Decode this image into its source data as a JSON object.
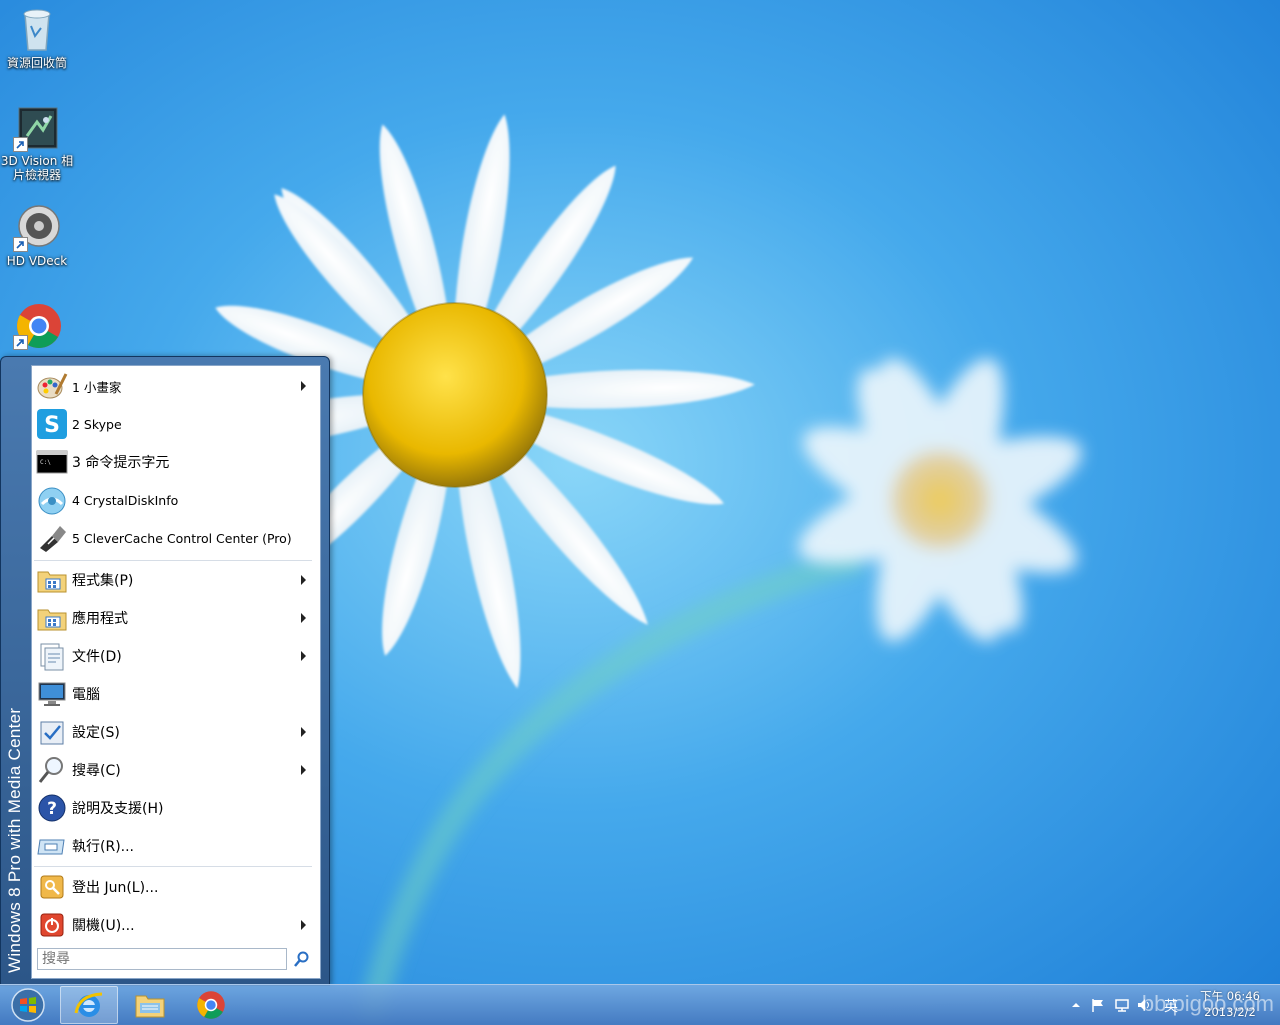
{
  "desktop": {
    "icons": [
      {
        "label": "資源回收筒",
        "icon": "recycle-bin-icon"
      },
      {
        "label": "3D Vision 相片檢視器",
        "icon": "3d-vision-icon"
      },
      {
        "label": "HD VDeck",
        "icon": "hd-vdeck-icon"
      },
      {
        "label": "Google Chrome",
        "icon": "chrome-icon"
      }
    ]
  },
  "start_menu": {
    "sidebar_text": "Windows 8 Pro with Media Center",
    "recent": [
      {
        "label": "1 小畫家",
        "icon": "paint-icon",
        "submenu": true
      },
      {
        "label": "2 Skype",
        "icon": "skype-icon",
        "submenu": false
      },
      {
        "label": "3 命令提示字元",
        "icon": "cmd-icon",
        "submenu": false
      },
      {
        "label": "4 CrystalDiskInfo",
        "icon": "crystaldiskinfo-icon",
        "submenu": false
      },
      {
        "label": "5 CleverCache Control Center (Pro)",
        "icon": "clevercache-icon",
        "submenu": false
      }
    ],
    "main": [
      {
        "label": "程式集(P)",
        "icon": "programs-folder-icon",
        "submenu": true
      },
      {
        "label": "應用程式",
        "icon": "apps-folder-icon",
        "submenu": true
      },
      {
        "label": "文件(D)",
        "icon": "documents-icon",
        "submenu": true
      },
      {
        "label": "電腦",
        "icon": "computer-icon",
        "submenu": false
      },
      {
        "label": "設定(S)",
        "icon": "settings-icon",
        "submenu": true
      },
      {
        "label": "搜尋(C)",
        "icon": "search-magnifier-icon",
        "submenu": true
      },
      {
        "label": "說明及支援(H)",
        "icon": "help-icon",
        "submenu": false
      },
      {
        "label": "執行(R)...",
        "icon": "run-icon",
        "submenu": false
      }
    ],
    "session": [
      {
        "label": "登出 Jun(L)...",
        "icon": "logoff-icon",
        "submenu": false
      },
      {
        "label": "關機(U)...",
        "icon": "shutdown-icon",
        "submenu": true
      }
    ],
    "search_placeholder": "搜尋"
  },
  "taskbar": {
    "pinned": [
      "internet-explorer-icon",
      "file-explorer-icon",
      "chrome-icon"
    ],
    "clock_time": "下午 06:46",
    "clock_date": "2013/2/2",
    "ime_label": "英",
    "watermark": "bb pigoo.com"
  }
}
